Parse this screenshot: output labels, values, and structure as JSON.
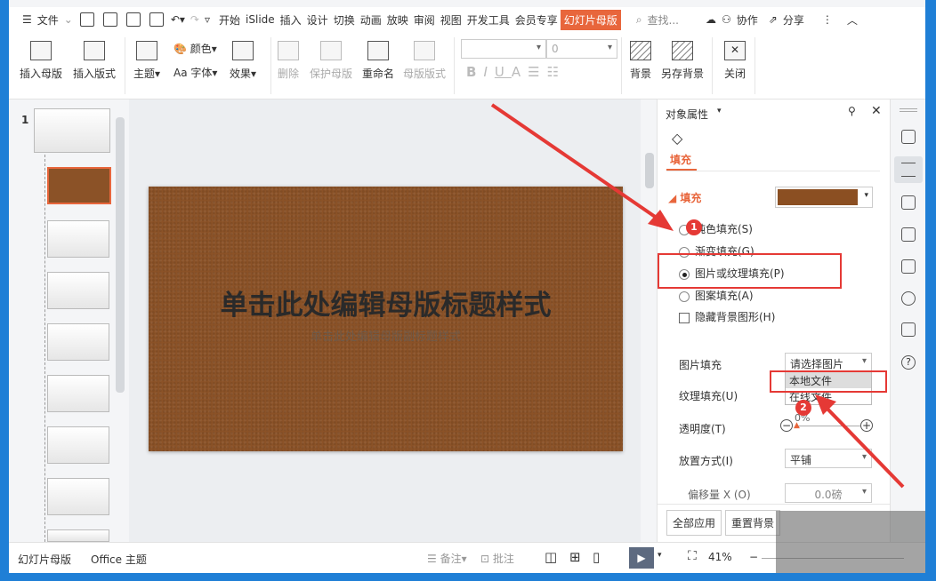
{
  "menubar": {
    "file": "文件",
    "tabs": [
      "开始",
      "iSlide",
      "插入",
      "设计",
      "切换",
      "动画",
      "放映",
      "审阅",
      "视图",
      "开发工具",
      "会员专享"
    ],
    "active_tab": "幻灯片母版",
    "search": "查找...",
    "collab": "协作",
    "share": "分享"
  },
  "ribbon": {
    "insert_master": "插入母版",
    "insert_layout": "插入版式",
    "theme": "主题",
    "color": "颜色",
    "font": "Aa 字体",
    "effect": "效果",
    "delete": "删除",
    "protect_master": "保护母版",
    "rename": "重命名",
    "master_layout": "母版版式",
    "font_size": "0",
    "background": "背景",
    "save_background": "另存背景",
    "close": "关闭"
  },
  "thumbs": {
    "slide_number": "1"
  },
  "slide": {
    "title": "单击此处编辑母版标题样式",
    "subtitle": "单击此处编辑母版副标题样式"
  },
  "panel": {
    "title": "对象属性",
    "tab": "填充",
    "section": "填充",
    "options": [
      "纯色填充(S)",
      "渐变填充(G)",
      "图片或纹理填充(P)",
      "图案填充(A)"
    ],
    "selected_option": 2,
    "hide_bg": "隐藏背景图形(H)",
    "picture_fill_label": "图片填充",
    "picture_fill_value": "请选择图片",
    "dropdown_items": [
      "本地文件",
      "在线文件"
    ],
    "texture_fill_label": "纹理填充(U)",
    "transparency_label": "透明度(T)",
    "transparency_value": "0%",
    "placement_label": "放置方式(I)",
    "placement_value": "平铺",
    "offset_label": "偏移量 X (O)",
    "offset_value": "0.0磅",
    "apply_all": "全部应用",
    "reset_bg": "重置背景"
  },
  "status": {
    "mode": "幻灯片母版",
    "theme": "Office 主题",
    "notes": "备注",
    "comments": "批注",
    "zoom": "41%"
  },
  "annotations": {
    "step1": "1",
    "step2": "2"
  },
  "colors": {
    "accent": "#e8663c",
    "annotation": "#e53935",
    "slide_bg": "#8b5227"
  }
}
